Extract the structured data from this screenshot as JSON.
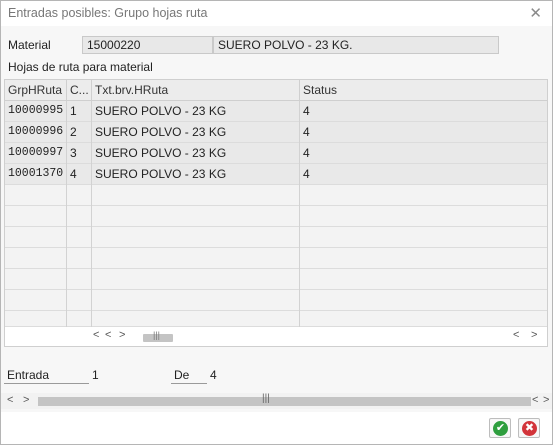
{
  "dialog": {
    "title": "Entradas posibles: Grupo hojas ruta",
    "close_glyph": "✕"
  },
  "header_fields": {
    "material_label": "Material",
    "material_value": "15000220",
    "material_desc": "SUERO POLVO - 23 KG."
  },
  "section_label": "Hojas de ruta para material",
  "table": {
    "columns": [
      "GrpHRuta",
      "C...",
      "Txt.brv.HRuta",
      "Status"
    ],
    "rows": [
      [
        "10000995",
        "1",
        "SUERO POLVO - 23 KG",
        "4"
      ],
      [
        "10000996",
        "2",
        "SUERO POLVO - 23 KG",
        "4"
      ],
      [
        "10000997",
        "3",
        "SUERO POLVO - 23 KG",
        "4"
      ],
      [
        "10001370",
        "4",
        "SUERO POLVO - 23 KG",
        "4"
      ]
    ]
  },
  "scroll_glyphs": {
    "left": "<",
    "right": ">",
    "thumb": "|||"
  },
  "footer_fields": {
    "entrada_label": "Entrada",
    "entrada_value": "1",
    "de_label": "De",
    "de_value": "4"
  },
  "buttons": {
    "confirm_glyph": "✔",
    "cancel_glyph": "✖"
  },
  "colors": {
    "confirm": "#2e9e3e",
    "cancel": "#d2343a"
  }
}
